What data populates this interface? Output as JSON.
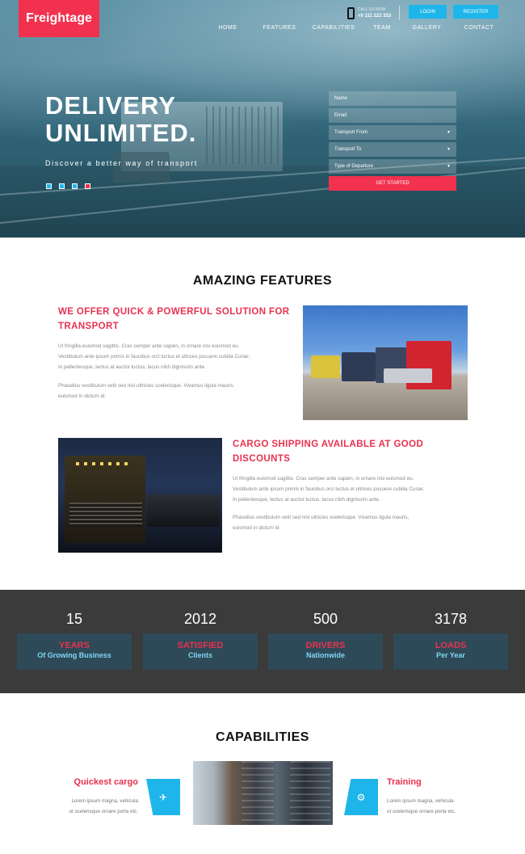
{
  "brand": {
    "name": "Freightage"
  },
  "header": {
    "call_label": "CALL US NOW",
    "phone": "+0 111 222 333",
    "login": "LOGIN",
    "register": "REGISTER"
  },
  "nav": [
    {
      "label": "HOME"
    },
    {
      "label": "FEATURES"
    },
    {
      "label": "CAPABILITIES"
    },
    {
      "label": "TEAM"
    },
    {
      "label": "GALLERY"
    },
    {
      "label": "CONTACT"
    }
  ],
  "hero": {
    "title_line1": "DELIVERY",
    "title_line2": "UNLIMITED.",
    "subtitle": "Discover a better way of transport"
  },
  "form": {
    "name_placeholder": "Name",
    "email_placeholder": "Email",
    "from_label": "Transport From",
    "to_label": "Transport To",
    "departure_label": "Type of Departure",
    "submit": "GET STARTED"
  },
  "features": {
    "title": "AMAZING FEATURES",
    "item1": {
      "h1": "WE OFFER QUICK & POWERFUL SOLUTION FOR",
      "h2": "TRANSPORT",
      "p1a": "Ut fringilla euismod sagittis. Cras semper ante sapien, in ornare nisi euismod eu.",
      "p1b": "Vestibulum ante ipsum primis in faucibus orci luctus et ultrices posuere cubilia Curae;",
      "p1c": "In pellentesque, lectus at auctor luctus, lacus nibh dignissim ante.",
      "p2a": "Phasellus vestibulum velit sed nisl ultricies scelerisque. Vivamus ligula mauris,",
      "p2b": "euismod in dictum id."
    },
    "item2": {
      "h1": "CARGO SHIPPING AVAILABLE AT GOOD",
      "h2": "DISCOUNTS",
      "p1a": "Ut fringilla euismod sagittis. Cras semper ante sapien, in ornare nisi euismod eu.",
      "p1b": "Vestibulum ante ipsum primis in faucibus orci luctus et ultrices posuere cubilia Curae;",
      "p1c": "In pellentesque, lectus at auctor luctus, lacus nibh dignissim ante.",
      "p2a": "Phasellus vestibulum velit sed nisl ultricies scelerisque. Vivamus ligula mauris,",
      "p2b": "euismod in dictum id."
    }
  },
  "stats": [
    {
      "number": "15",
      "label1": "YEARS",
      "label2": "Of Growing Business"
    },
    {
      "number": "2012",
      "label1": "SATISFIED",
      "label2": "Clients"
    },
    {
      "number": "500",
      "label1": "DRIVERS",
      "label2": "Nationwide"
    },
    {
      "number": "3178",
      "label1": "LOADS",
      "label2": "Per Year"
    }
  ],
  "capabilities": {
    "title": "CAPABILITIES",
    "left": {
      "title": "Quickest cargo",
      "line1": "Lorem ipsum magna, vehicula",
      "line2": "ut scelerisque ornare porta etc.",
      "icon": "airplane-icon"
    },
    "right": {
      "title": "Training",
      "line1": "Lorem ipsum magna, vehicula",
      "line2": "ut scelerisque ornare porta etc.",
      "icon": "gears-icon"
    }
  },
  "colors": {
    "accent": "#f2314e",
    "blue": "#1eb6ea",
    "stats_bg": "#3b3b3b",
    "stat_box": "#2e4a58"
  }
}
